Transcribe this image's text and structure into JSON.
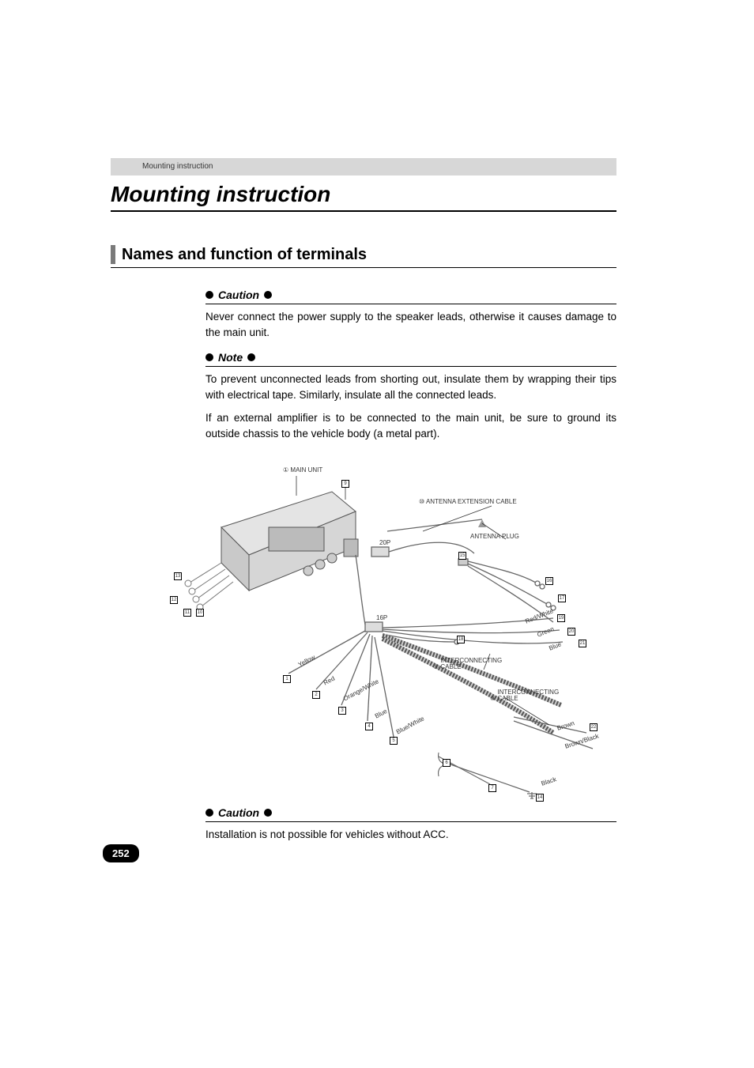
{
  "header": {
    "breadcrumb": "Mounting instruction"
  },
  "title": "Mounting instruction",
  "section": "Names and function of terminals",
  "caution1": {
    "label": "Caution",
    "body": "Never connect the power supply to the speaker leads, otherwise it causes damage to the main unit."
  },
  "note": {
    "label": "Note",
    "p1": "To prevent unconnected leads from shorting out, insulate them by wrapping their tips with electrical tape. Similarly, insulate all the connected leads.",
    "p2": "If an external amplifier is to be connected to the main unit, be sure to ground its outside chassis to the vehicle body (a metal part)."
  },
  "diagram": {
    "main_unit": "MAIN UNIT",
    "main_unit_num": "①",
    "antenna_ext": "ANTENNA EXTENSION CABLE",
    "antenna_ext_num": "⑩",
    "antenna_plug": "ANTENNA PLUG",
    "conn_20p": "20P",
    "conn_16p": "16P",
    "interconnecting9": "INTERCONNECTING CABLE",
    "interconnecting9_num": "⑨",
    "interconnecting8": "INTERCONNECTING CABLE",
    "interconnecting8_num": "⑧",
    "color_yellow": "Yellow",
    "color_red": "Red",
    "color_orange_white": "Orange/White",
    "color_blue": "Blue",
    "color_blue_white": "Blue/White",
    "color_red_white": "Red/White",
    "color_green": "Green",
    "color_blue2": "Blue",
    "color_brown": "Brown",
    "color_brown_black": "Brown/Black",
    "color_black": "Black",
    "box_1": "1",
    "box_2": "2",
    "box_3": "3",
    "box_4": "4",
    "box_5": "5",
    "box_6": "6",
    "box_7": "7",
    "box_8": "8",
    "box_9": "9",
    "box_10": "10",
    "box_11": "11",
    "box_12": "12",
    "box_13": "13",
    "box_14": "14",
    "box_15": "15",
    "box_16": "16",
    "box_17": "17",
    "box_18": "18",
    "box_19": "19",
    "box_20": "20",
    "box_21": "21",
    "box_22": "22"
  },
  "caution2": {
    "label": "Caution",
    "body": "Installation is not possible for vehicles without ACC."
  },
  "page_number": "252"
}
